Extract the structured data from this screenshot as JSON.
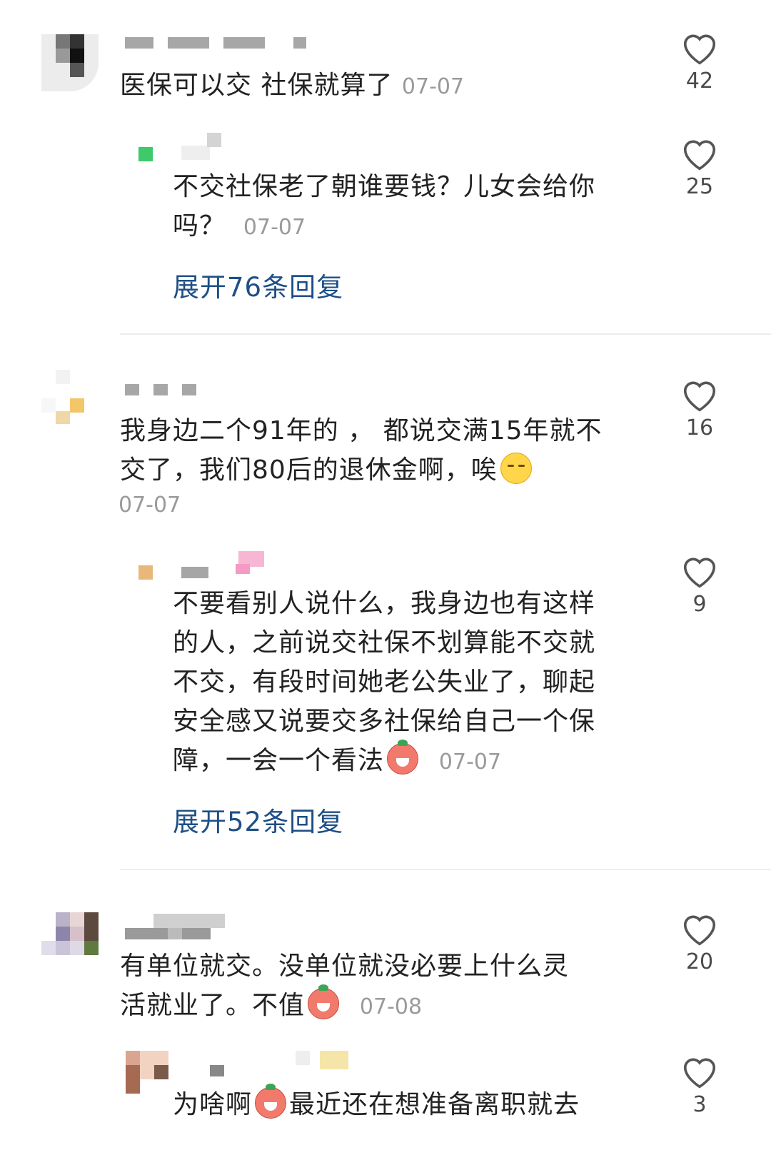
{
  "comments": [
    {
      "text": "医保可以交 社保就算了",
      "date": "07-07",
      "likes": "42",
      "reply": {
        "text_line1": "不交社保老了朝谁要钱？儿女会给你",
        "text_line2": "吗？",
        "date": "07-07",
        "likes": "25"
      },
      "expand_label": "展开76条回复"
    },
    {
      "text_line1": "我身边二个91年的 ， 都说交满15年就不",
      "text_line2": "交了，我们80后的退休金啊，唉",
      "date": "07-07",
      "likes": "16",
      "reply": {
        "line1": "不要看别人说什么，我身边也有这样",
        "line2": "的人，之前说交社保不划算能不交就",
        "line3": "不交，有段时间她老公失业了，聊起",
        "line4": "安全感又说要交多社保给自己一个保",
        "line5": "障，一会一个看法",
        "date": "07-07",
        "likes": "9"
      },
      "expand_label": "展开52条回复"
    },
    {
      "text_line1": "有单位就交。没单位就没必要上什么灵",
      "text_line2": "活就业了。不值",
      "date": "07-08",
      "likes": "20",
      "reply": {
        "line1_a": "为啥啊",
        "line1_b": "最近还在想准备离职就去",
        "likes": "3"
      }
    }
  ],
  "icons": {
    "like": "heart-outline-icon",
    "sad": "pensive-face-emoji",
    "angry": "angry-face-emoji"
  }
}
